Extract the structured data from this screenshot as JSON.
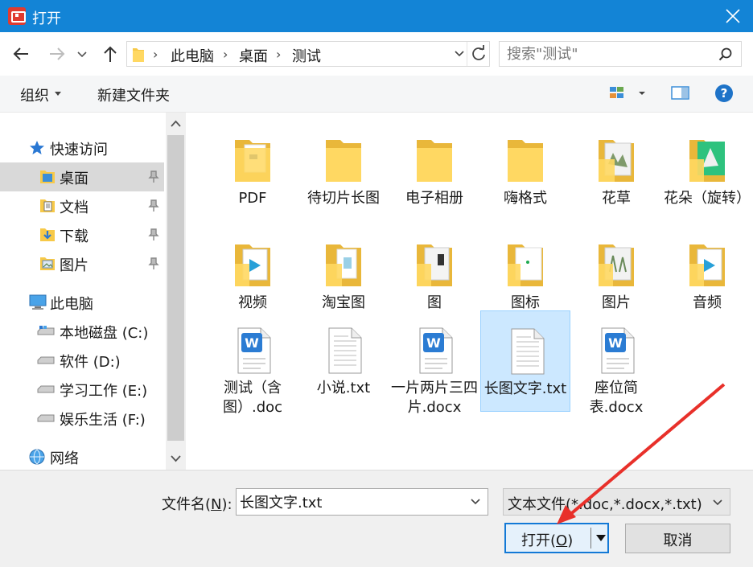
{
  "window": {
    "title": "打开",
    "accent": "#1384d6"
  },
  "breadcrumb": [
    "此电脑",
    "桌面",
    "测试"
  ],
  "search": {
    "placeholder": "搜索\"测试\""
  },
  "toolbar": {
    "organize": "组织",
    "new_folder": "新建文件夹"
  },
  "nav": {
    "quick_access": "快速访问",
    "items": [
      {
        "label": "桌面",
        "icon": "folder-blue-icon",
        "pinned": true,
        "selected": true
      },
      {
        "label": "文档",
        "icon": "documents-icon",
        "pinned": true
      },
      {
        "label": "下载",
        "icon": "downloads-icon",
        "pinned": true
      },
      {
        "label": "图片",
        "icon": "pictures-icon",
        "pinned": true
      }
    ],
    "this_pc": "此电脑",
    "drives": [
      "本地磁盘 (C:)",
      "软件 (D:)",
      "学习工作 (E:)",
      "娱乐生活 (F:)"
    ],
    "network": "网络"
  },
  "files": [
    {
      "name": "PDF",
      "kind": "folder-doc"
    },
    {
      "name": "待切片长图",
      "kind": "folder"
    },
    {
      "name": "电子相册",
      "kind": "folder"
    },
    {
      "name": "嗨格式",
      "kind": "folder"
    },
    {
      "name": "花草",
      "kind": "folder-photo"
    },
    {
      "name": "花朵（旋转）",
      "kind": "folder-green"
    },
    {
      "name": "视频",
      "kind": "folder-media"
    },
    {
      "name": "淘宝图",
      "kind": "folder-doc"
    },
    {
      "name": "图",
      "kind": "folder-photo"
    },
    {
      "name": "图标",
      "kind": "folder-white"
    },
    {
      "name": "图片",
      "kind": "folder-photo"
    },
    {
      "name": "音频",
      "kind": "folder-media"
    },
    {
      "name": "测试（含图）.doc",
      "kind": "word"
    },
    {
      "name": "小说.txt",
      "kind": "txt"
    },
    {
      "name": "一片两片三四片.docx",
      "kind": "word"
    },
    {
      "name": "长图文字.txt",
      "kind": "txt",
      "selected": true
    },
    {
      "name": "座位简表.docx",
      "kind": "word"
    }
  ],
  "filename": {
    "label": "文件名",
    "accel": "N",
    "value": "长图文字.txt"
  },
  "filetype": {
    "value": "文本文件(*.doc,*.docx,*.txt)"
  },
  "buttons": {
    "open": "打开",
    "open_accel": "O",
    "cancel": "取消"
  }
}
